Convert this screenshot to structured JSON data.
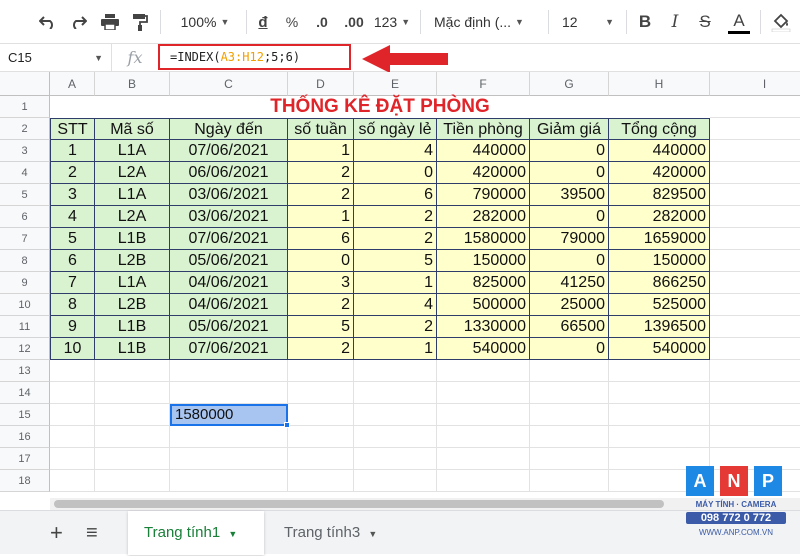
{
  "toolbar": {
    "zoom": "100%",
    "currency": "đ",
    "percent": "%",
    "dec_decrease": ".0",
    "dec_increase": ".00",
    "number_format": "123",
    "font": "Mặc định (...",
    "font_size": "12",
    "bold": "B",
    "italic": "I",
    "strike": "S",
    "text_color": "A"
  },
  "formula_bar": {
    "cell_ref": "C15",
    "fx": "fx",
    "formula_prefix": "=INDEX(",
    "formula_range": "A3:H12",
    "formula_suffix": ";5;6)"
  },
  "columns": [
    "A",
    "B",
    "C",
    "D",
    "E",
    "F",
    "G",
    "H",
    "I"
  ],
  "rows": [
    "1",
    "2",
    "3",
    "4",
    "5",
    "6",
    "7",
    "8",
    "9",
    "10",
    "11",
    "12",
    "13",
    "14",
    "15",
    "16",
    "17",
    "18"
  ],
  "sheet": {
    "title": "THỐNG KÊ ĐẶT PHÒNG",
    "headers": [
      "STT",
      "Mã số",
      "Ngày đến",
      "số tuần",
      "số ngày lẻ",
      "Tiền phòng",
      "Giảm giá",
      "Tổng cộng"
    ],
    "data": [
      [
        "1",
        "L1A",
        "07/06/2021",
        "1",
        "4",
        "440000",
        "0",
        "440000"
      ],
      [
        "2",
        "L2A",
        "06/06/2021",
        "2",
        "0",
        "420000",
        "0",
        "420000"
      ],
      [
        "3",
        "L1A",
        "03/06/2021",
        "2",
        "6",
        "790000",
        "39500",
        "829500"
      ],
      [
        "4",
        "L2A",
        "03/06/2021",
        "1",
        "2",
        "282000",
        "0",
        "282000"
      ],
      [
        "5",
        "L1B",
        "07/06/2021",
        "6",
        "2",
        "1580000",
        "79000",
        "1659000"
      ],
      [
        "6",
        "L2B",
        "05/06/2021",
        "0",
        "5",
        "150000",
        "0",
        "150000"
      ],
      [
        "7",
        "L1A",
        "04/06/2021",
        "3",
        "1",
        "825000",
        "41250",
        "866250"
      ],
      [
        "8",
        "L2B",
        "04/06/2021",
        "2",
        "4",
        "500000",
        "25000",
        "525000"
      ],
      [
        "9",
        "L1B",
        "05/06/2021",
        "5",
        "2",
        "1330000",
        "66500",
        "1396500"
      ],
      [
        "10",
        "L1B",
        "07/06/2021",
        "2",
        "1",
        "540000",
        "0",
        "540000"
      ]
    ],
    "result_value": "1580000"
  },
  "tabs": {
    "add": "+",
    "list": "≡",
    "sheet1": "Trang tính1",
    "sheet3": "Trang tính3"
  },
  "logo": {
    "letters": [
      "A",
      "N",
      "P"
    ],
    "line1": "MÁY TÍNH · CAMERA",
    "phone": "098 772 0 772",
    "site": "WWW.ANP.COM.VN"
  },
  "colors": {
    "accent_red": "#e0252a",
    "green_fill": "#d9f2d0",
    "yellow_fill": "#ffffcc",
    "selection": "#1a73e8"
  }
}
